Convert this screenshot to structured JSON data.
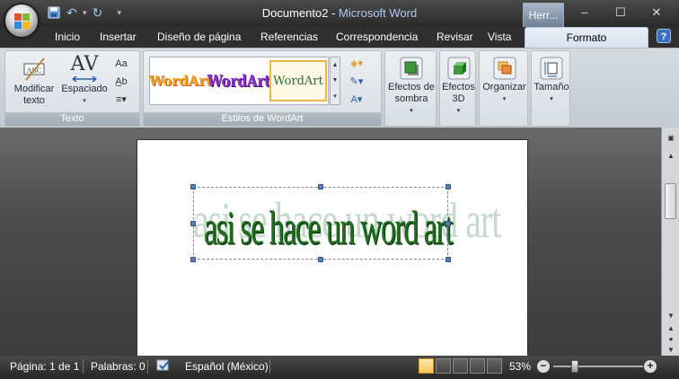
{
  "titlebar": {
    "doc_name": "Documento2",
    "separator": " - ",
    "app_name": "Microsoft Word",
    "context_tab": "Herr...",
    "controls": {
      "minimize": "–",
      "maximize": "☐",
      "close": "✕"
    },
    "qat": {
      "save": "save-icon",
      "undo": "↶",
      "undo_dd": "▾",
      "redo": "↻",
      "customize": "▾"
    }
  },
  "tabs": [
    "Inicio",
    "Insertar",
    "Diseño de página",
    "Referencias",
    "Correspondencia",
    "Revisar",
    "Vista"
  ],
  "active_tab": "Formato",
  "help": "?",
  "ribbon": {
    "texto": {
      "label": "Texto",
      "edit_text": "Modificar texto",
      "spacing": "Espaciado",
      "spacing_icon": "AV",
      "edit_icon": "ABC"
    },
    "estilos": {
      "label": "Estilos de WordArt",
      "styles": [
        "WordArt",
        "WordArt",
        "WordArt"
      ]
    },
    "efectos_sombra": {
      "label": "Efectos de sombra"
    },
    "efectos_3d": {
      "label": "Efectos 3D"
    },
    "organizar": {
      "label": "Organizar"
    },
    "tamano": {
      "label": "Tamaño"
    }
  },
  "document": {
    "wordart_text": "asi se hace un word art"
  },
  "statusbar": {
    "page": "Página: 1 de 1",
    "words": "Palabras: 0",
    "language": "Español (México)",
    "zoom": "53%",
    "zoom_minus": "−",
    "zoom_plus": "+"
  },
  "colors": {
    "wordart_green": "#1f6e1f",
    "wordart_shadow": "#c7d8cf",
    "ribbon_bg": "#d6dbe0",
    "title_app": "#aecbf0"
  }
}
